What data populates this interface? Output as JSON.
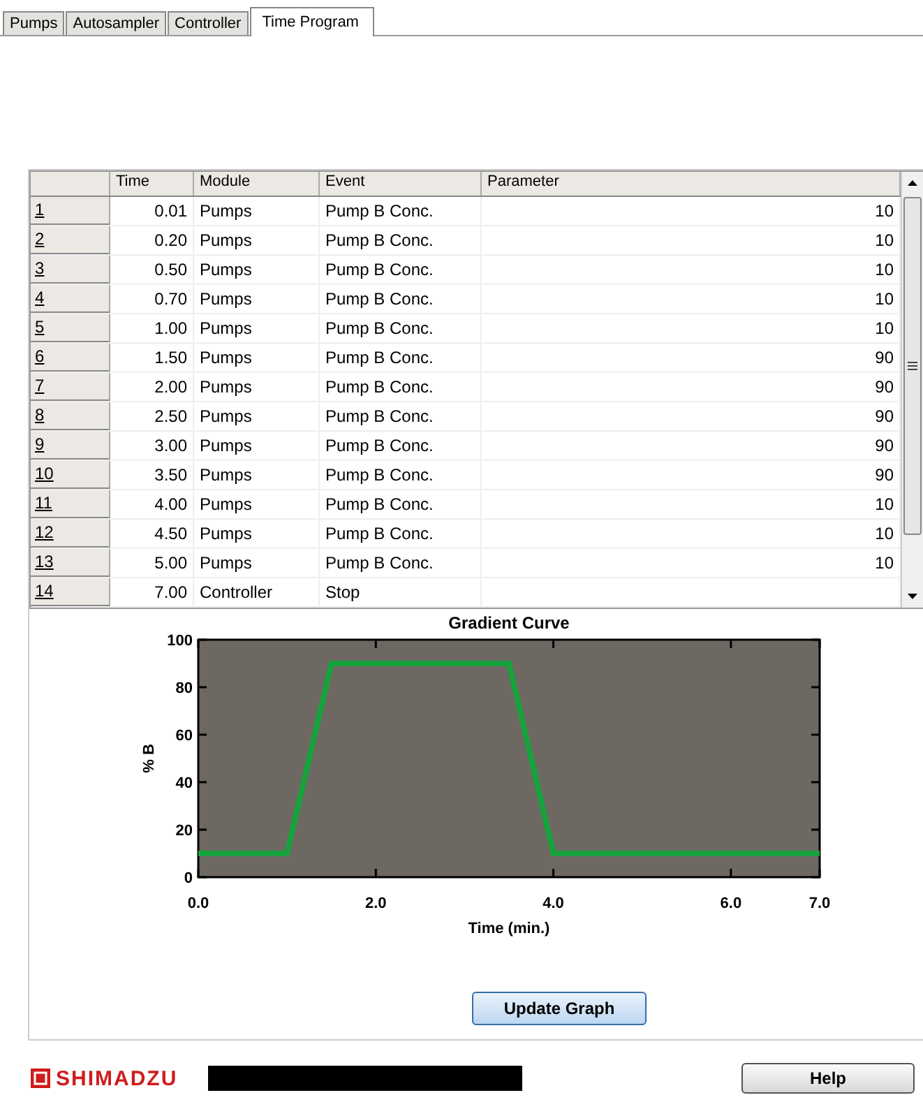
{
  "tabs": [
    {
      "label": "Pumps",
      "selected": false
    },
    {
      "label": "Autosampler",
      "selected": false
    },
    {
      "label": "Controller",
      "selected": false
    },
    {
      "label": "Time Program",
      "selected": true
    }
  ],
  "table": {
    "columns": [
      "Time",
      "Module",
      "Event",
      "Parameter"
    ],
    "rows": [
      {
        "number": "1",
        "time": "0.01",
        "module": "Pumps",
        "event": "Pump B Conc.",
        "parameter": "10"
      },
      {
        "number": "2",
        "time": "0.20",
        "module": "Pumps",
        "event": "Pump B Conc.",
        "parameter": "10"
      },
      {
        "number": "3",
        "time": "0.50",
        "module": "Pumps",
        "event": "Pump B Conc.",
        "parameter": "10"
      },
      {
        "number": "4",
        "time": "0.70",
        "module": "Pumps",
        "event": "Pump B Conc.",
        "parameter": "10"
      },
      {
        "number": "5",
        "time": "1.00",
        "module": "Pumps",
        "event": "Pump B Conc.",
        "parameter": "10"
      },
      {
        "number": "6",
        "time": "1.50",
        "module": "Pumps",
        "event": "Pump B Conc.",
        "parameter": "90"
      },
      {
        "number": "7",
        "time": "2.00",
        "module": "Pumps",
        "event": "Pump B Conc.",
        "parameter": "90"
      },
      {
        "number": "8",
        "time": "2.50",
        "module": "Pumps",
        "event": "Pump B Conc.",
        "parameter": "90"
      },
      {
        "number": "9",
        "time": "3.00",
        "module": "Pumps",
        "event": "Pump B Conc.",
        "parameter": "90"
      },
      {
        "number": "10",
        "time": "3.50",
        "module": "Pumps",
        "event": "Pump B Conc.",
        "parameter": "90"
      },
      {
        "number": "11",
        "time": "4.00",
        "module": "Pumps",
        "event": "Pump B Conc.",
        "parameter": "10"
      },
      {
        "number": "12",
        "time": "4.50",
        "module": "Pumps",
        "event": "Pump B Conc.",
        "parameter": "10"
      },
      {
        "number": "13",
        "time": "5.00",
        "module": "Pumps",
        "event": "Pump B Conc.",
        "parameter": "10"
      },
      {
        "number": "14",
        "time": "7.00",
        "module": "Controller",
        "event": "Stop"
      }
    ]
  },
  "chart_data": {
    "type": "line",
    "title": "Gradient Curve",
    "xlabel": "Time (min.)",
    "ylabel": "% B",
    "x": [
      0,
      1,
      1.5,
      3.5,
      4,
      7
    ],
    "series": [
      {
        "color": "#16a23c",
        "values": [
          10,
          10,
          90,
          90,
          10,
          10
        ]
      }
    ],
    "xlim": [
      0,
      7
    ],
    "ylim": [
      0,
      100
    ],
    "xticks": [
      {
        "value": 0,
        "label": "0.0"
      },
      {
        "value": 2,
        "label": "2.0"
      },
      {
        "value": 4,
        "label": "4.0"
      },
      {
        "value": 6,
        "label": "6.0"
      },
      {
        "value": 7,
        "label": "7.0"
      }
    ],
    "yticks": [
      0,
      20,
      40,
      60,
      80,
      100
    ]
  },
  "update_button": "Update Graph",
  "logo": "SHIMADZU",
  "help_button": "Help"
}
